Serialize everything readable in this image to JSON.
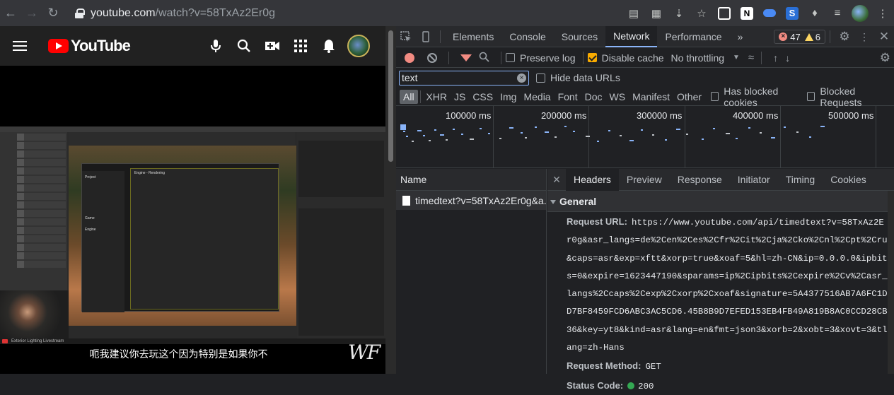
{
  "browser": {
    "url_host": "youtube.com",
    "url_path": "/watch?v=58TxAz2Er0g"
  },
  "youtube": {
    "logo_text": "YouTube",
    "subtitle": "呃我建议你去玩这个因为特别是如果你不",
    "watermark": "WF",
    "stream_label": "Exterior Lighting Livestream",
    "ue_dialog_title": "Engine - Rendering",
    "ue_sections": [
      "Project",
      "Game",
      "Engine"
    ]
  },
  "devtools": {
    "tabs": [
      "Elements",
      "Console",
      "Sources",
      "Network",
      "Performance"
    ],
    "more": "»",
    "error_count": "47",
    "warning_count": "6",
    "preserve_log": "Preserve log",
    "disable_cache": "Disable cache",
    "throttling": "No throttling",
    "filter_value": "text",
    "hide_data_urls": "Hide data URLs",
    "types": [
      "All",
      "XHR",
      "JS",
      "CSS",
      "Img",
      "Media",
      "Font",
      "Doc",
      "WS",
      "Manifest",
      "Other"
    ],
    "has_blocked_cookies": "Has blocked cookies",
    "blocked_requests": "Blocked Requests",
    "timeline_ticks": [
      "100000 ms",
      "200000 ms",
      "300000 ms",
      "400000 ms",
      "500000 ms"
    ],
    "name_header": "Name",
    "request_name": "timedtext?v=58TxAz2Er0g&a...",
    "detail_tabs": [
      "Headers",
      "Preview",
      "Response",
      "Initiator",
      "Timing",
      "Cookies"
    ],
    "general": "General",
    "request_url_label": "Request URL:",
    "request_url": "https://www.youtube.com/api/timedtext?v=58TxAz2Er0g&asr_langs=de%2Cen%2Ces%2Cfr%2Cit%2Cja%2Cko%2Cnl%2Cpt%2Cru&caps=asr&exp=xftt&xorp=true&xoaf=5&hl=zh-CN&ip=0.0.0.0&ipbits=0&expire=1623447190&sparams=ip%2Cipbits%2Cexpire%2Cv%2Casr_langs%2Ccaps%2Cexp%2Cxorp%2Cxoaf&signature=5A4377516AB7A6FC1DD7BF8459FCD6ABC3AC5CD6.45B8B9D7EFED153EB4FB49A819B8AC0CCD28CB36&key=yt8&kind=asr&lang=en&fmt=json3&xorb=2&xobt=3&xovt=3&tlang=zh-Hans",
    "request_method_label": "Request Method:",
    "request_method": "GET",
    "status_code_label": "Status Code:",
    "status_code": "200"
  }
}
